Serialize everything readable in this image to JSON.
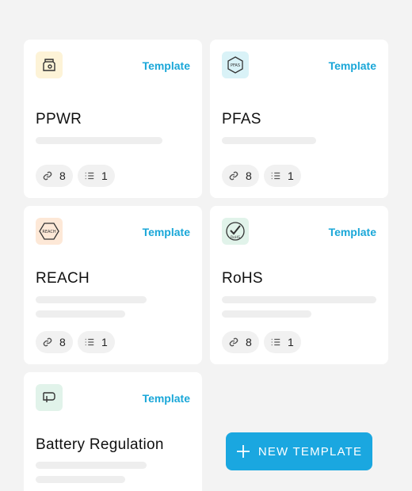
{
  "cards": [
    {
      "name": "PPWR",
      "tag": "Template",
      "links": "8",
      "items": "1",
      "icon": "pouch-icon",
      "icon_bg": "#fdf3d7"
    },
    {
      "name": "PFAS",
      "tag": "Template",
      "links": "8",
      "items": "1",
      "icon": "pfas-hexagon-icon",
      "icon_bg": "#d9f2f7",
      "icon_text": "PFAS"
    },
    {
      "name": "REACH",
      "tag": "Template",
      "links": "8",
      "items": "1",
      "icon": "reach-hexagon-icon",
      "icon_bg": "#fde8d7",
      "icon_text": "REACH"
    },
    {
      "name": "RoHS",
      "tag": "Template",
      "links": "8",
      "items": "1",
      "icon": "rohs-check-icon",
      "icon_bg": "#e1f3ea",
      "icon_text": "RoHS"
    },
    {
      "name": "Battery Regulation",
      "tag": "Template",
      "icon": "battery-plug-icon",
      "icon_bg": "#e1f3ea"
    }
  ],
  "new_button": {
    "label": "NEW TEMPLATE"
  }
}
